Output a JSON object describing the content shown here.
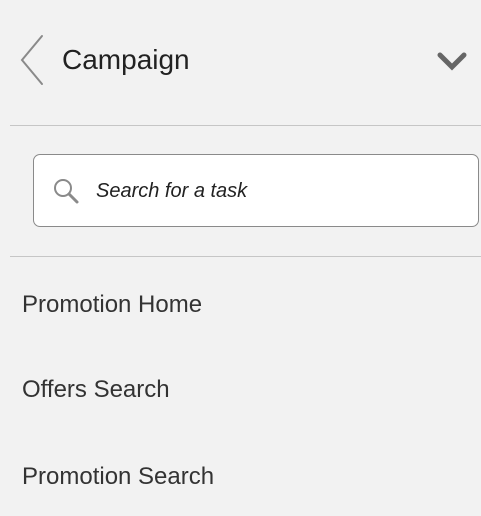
{
  "header": {
    "title": "Campaign",
    "back_icon": "chevron-left-icon",
    "collapse_icon": "chevron-down-icon"
  },
  "search": {
    "placeholder": "Search for a task",
    "value": "",
    "icon": "search-icon"
  },
  "nav": {
    "items": [
      {
        "label": "Promotion Home"
      },
      {
        "label": "Offers Search"
      },
      {
        "label": "Promotion Search"
      }
    ]
  },
  "colors": {
    "background": "#f2f2f2",
    "text": "#222222",
    "divider": "#c6c6c6",
    "input_border": "#8a8a8a",
    "icon": "#777777"
  }
}
